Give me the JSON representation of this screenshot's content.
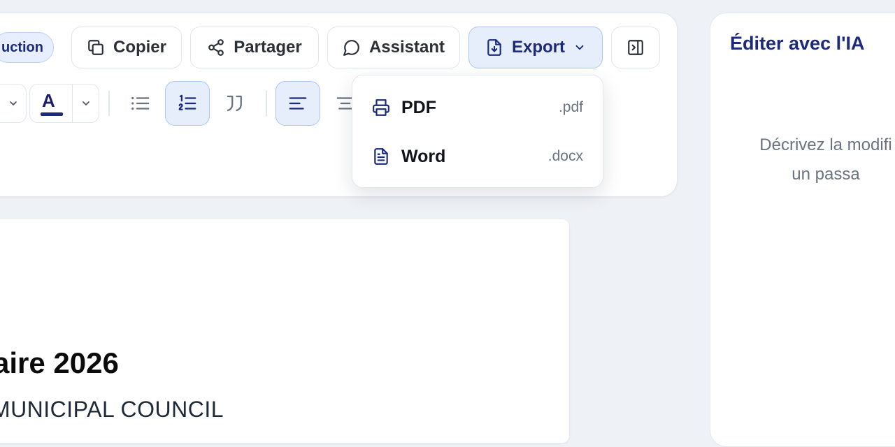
{
  "toolbar": {
    "mode_pill_label": "uction",
    "copy_label": "Copier",
    "share_label": "Partager",
    "assistant_label": "Assistant",
    "export_label": "Export",
    "text_color_letter": "A"
  },
  "export_menu": {
    "items": [
      {
        "label": "PDF",
        "ext": ".pdf",
        "icon": "printer-icon"
      },
      {
        "label": "Word",
        "ext": ".docx",
        "icon": "document-icon"
      }
    ]
  },
  "document": {
    "title_visible": "aire 2026",
    "subtitle_visible": "MUNICIPAL COUNCIL"
  },
  "ai_panel": {
    "title": "Éditer avec l'IA",
    "hint_line1": "Décrivez la modifi",
    "hint_line2": "un passa"
  },
  "colors": {
    "accent": "#1b2a7a",
    "accent_bg": "#e6eefc",
    "page_bg": "#eef1f6"
  }
}
